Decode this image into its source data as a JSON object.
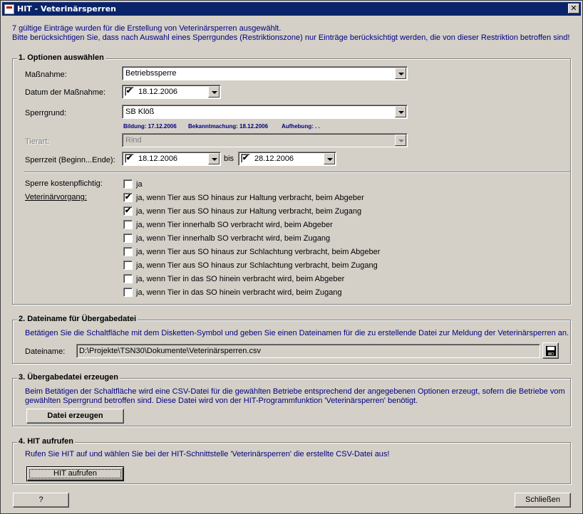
{
  "window": {
    "title": "HIT - Veterinärsperren",
    "close_label": "✕"
  },
  "info": {
    "line1": "7 gültige Einträge wurden für die Erstellung von Veterinärsperren ausgewählt.",
    "line2": "Bitte berücksichtigen Sie, dass nach Auswahl eines Sperrgundes (Restriktionszone) nur Einträge berücksichtigt werden, die von dieser Restriktion betroffen sind!"
  },
  "section1": {
    "title": "1. Optionen auswählen",
    "massnahme_label": "Maßnahme:",
    "massnahme_value": "Betriebssperre",
    "datum_label": "Datum der Maßnahme:",
    "datum_value": "18.12.2006",
    "datum_checked": true,
    "sperrgrund_label": "Sperrgrund:",
    "sperrgrund_value": "SB Klöß",
    "bildung": "Bildung: 17.12.2006",
    "bekanntmachung": "Bekanntmachung: 18.12.2006",
    "aufhebung": "Aufhebung:  .  .",
    "tierart_label": "Tierart:",
    "tierart_value": "Rind",
    "sperrzeit_label": "Sperrzeit (Beginn...Ende):",
    "sperrzeit_begin": "18.12.2006",
    "bis_label": "bis",
    "sperrzeit_end": "28.12.2006",
    "kosten_label": "Sperre kostenpflichtig:",
    "kosten_option": "ja",
    "vorgang_label": "Veterinärvorgang:",
    "vorgang_options": [
      {
        "label": "ja, wenn Tier aus SO hinaus zur Haltung verbracht, beim Abgeber",
        "checked": true
      },
      {
        "label": "ja, wenn Tier aus SO hinaus zur Haltung verbracht, beim Zugang",
        "checked": true
      },
      {
        "label": "ja, wenn Tier  innerhalb SO verbracht wird, beim Abgeber",
        "checked": false
      },
      {
        "label": "ja, wenn Tier  innerhalb SO verbracht wird, beim Zugang",
        "checked": false
      },
      {
        "label": "ja, wenn Tier aus SO hinaus zur Schlachtung verbracht, beim Abgeber",
        "checked": false
      },
      {
        "label": "ja, wenn Tier aus SO hinaus zur Schlachtung verbracht, beim Zugang",
        "checked": false
      },
      {
        "label": "ja, wenn Tier in das SO hinein verbracht wird, beim Abgeber",
        "checked": false
      },
      {
        "label": "ja, wenn Tier in das SO hinein verbracht wird, beim Zugang",
        "checked": false
      }
    ]
  },
  "section2": {
    "title": "2. Dateiname für Übergabedatei",
    "desc": "Betätigen Sie die Schaltfläche mit dem Disketten-Symbol und geben Sie einen Dateinamen für die zu erstellende Datei zur Meldung der Veterinärsperren an.",
    "dateiname_label": "Dateiname:",
    "dateiname_value": "D:\\Projekte\\TSN30\\Dokumente\\Veterinärsperren.csv"
  },
  "section3": {
    "title": "3. Übergabedatei erzeugen",
    "desc1": "Beim Betätigen der Schaltfläche wird eine CSV-Datei für die gewählten Betriebe entsprechend der angegebenen Optionen erzeugt, sofern die Betriebe vom",
    "desc2": "gewählten Sperrgrund betroffen sind. Diese Datei wird von der HIT-Programmfunktion 'Veterinärsperren' benötigt.",
    "button_label": "Datei erzeugen"
  },
  "section4": {
    "title": "4. HIT aufrufen",
    "desc": "Rufen Sie HIT auf und wählen Sie bei der HIT-Schnittstelle 'Veterinärsperren' die erstellte CSV-Datei aus!",
    "button_label": "HIT aufrufen"
  },
  "footer": {
    "help_label": "?",
    "close_label": "Schließen"
  },
  "icons": {
    "save": "floppy-disk-icon",
    "dropdown": "chevron-down-icon",
    "check": "✔"
  }
}
